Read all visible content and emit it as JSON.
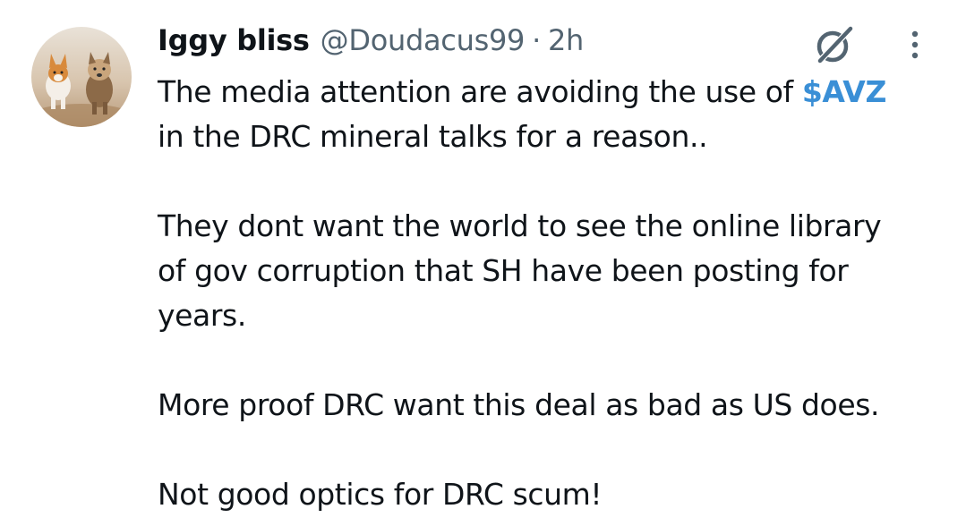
{
  "tweet": {
    "author": {
      "display_name": "Iggy bliss",
      "handle": "@Doudacus99",
      "separator": "·",
      "time": "2h"
    },
    "icons": {
      "grok": "grok-icon",
      "more": "more-options-icon",
      "avatar": "avatar-two-dogs"
    },
    "text": {
      "line1_before": "The media attention are avoiding the use of ",
      "cashtag": "$AVZ",
      "line2": "in the DRC mineral talks for a reason..",
      "line3": "They dont want the world to see the online library",
      "line4": "of gov corruption that SH have been posting for",
      "line5": "years.",
      "line6": "More proof DRC want this deal as bad as US does.",
      "line7": "Not good optics for DRC scum!"
    },
    "colors": {
      "text": "#0f1419",
      "secondary": "#536471",
      "link": "#3a8fd6"
    }
  }
}
